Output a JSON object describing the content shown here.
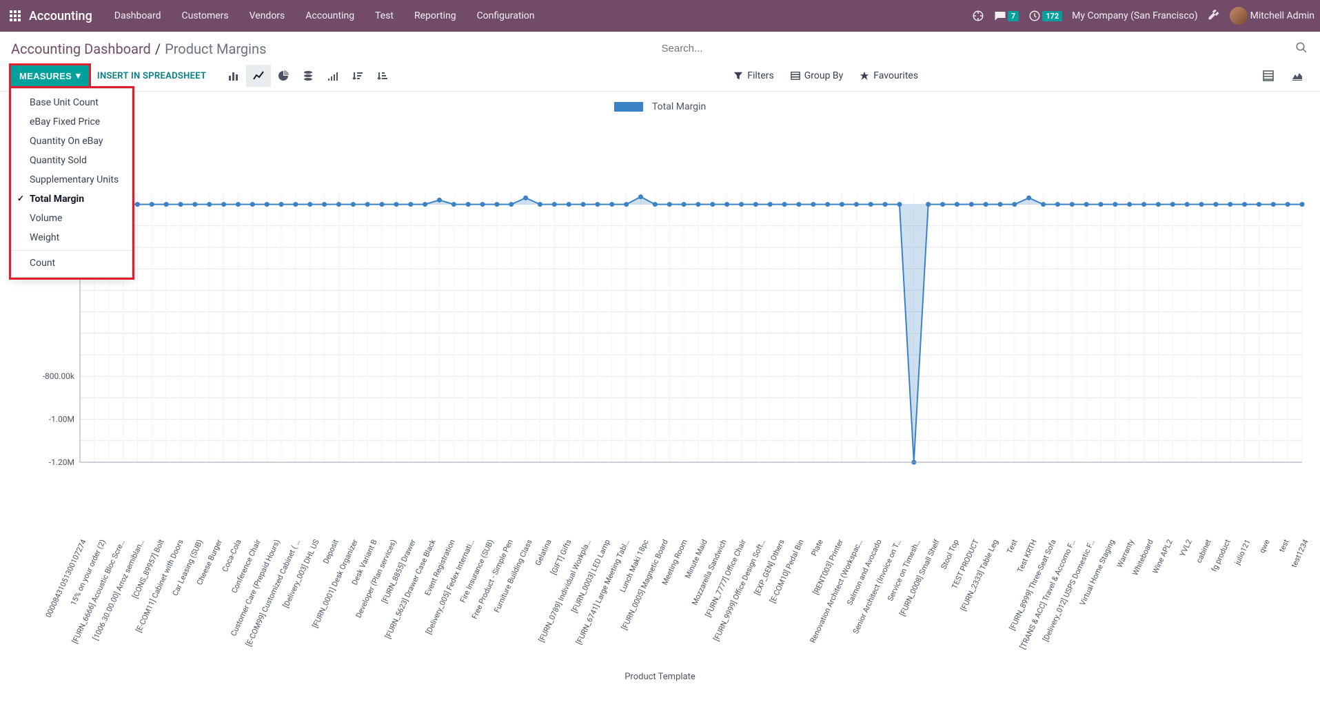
{
  "topbar": {
    "brand": "Accounting",
    "menu": [
      "Dashboard",
      "Customers",
      "Vendors",
      "Accounting",
      "Test",
      "Reporting",
      "Configuration"
    ],
    "msg_badge": "7",
    "clock_badge": "172",
    "company": "My Company (San Francisco)",
    "user": "Mitchell Admin"
  },
  "breadcrumb": {
    "parent": "Accounting Dashboard",
    "current": "Product Margins"
  },
  "search": {
    "placeholder": "Search..."
  },
  "buttons": {
    "measures": "MEASURES",
    "insert": "INSERT IN SPREADSHEET",
    "filters": "Filters",
    "groupby": "Group By",
    "favourites": "Favourites"
  },
  "measures_menu": {
    "items": [
      "Base Unit Count",
      "eBay Fixed Price",
      "Quantity On eBay",
      "Quantity Sold",
      "Supplementary Units",
      "Total Margin",
      "Volume",
      "Weight"
    ],
    "selected": "Total Margin",
    "footer": "Count"
  },
  "legend": {
    "label": "Total Margin"
  },
  "xlabel": "Product Template",
  "chart_data": {
    "type": "line",
    "title": "",
    "xlabel": "Product Template",
    "ylabel": "",
    "ylim": [
      -1200000,
      50000
    ],
    "yticks": [
      -1200000,
      -1000000,
      -800000
    ],
    "ytick_labels": [
      "-1.20M",
      "-1.00M",
      "-800.00k"
    ],
    "series": [
      {
        "name": "Total Margin",
        "values": [
          0,
          0,
          0,
          0,
          0,
          0,
          0,
          0,
          0,
          0,
          0,
          0,
          0,
          0,
          0,
          0,
          0,
          0,
          0,
          0,
          0,
          0,
          0,
          0,
          0,
          20000,
          0,
          0,
          0,
          0,
          0,
          30000,
          0,
          0,
          0,
          0,
          0,
          0,
          0,
          35000,
          0,
          0,
          0,
          0,
          0,
          0,
          0,
          0,
          0,
          0,
          0,
          0,
          0,
          0,
          0,
          0,
          0,
          0,
          -1200000,
          0,
          0,
          0,
          0,
          0,
          0,
          0,
          30000,
          0,
          0,
          0,
          0,
          0,
          0,
          0,
          0,
          0,
          0,
          0,
          0,
          0,
          0,
          0,
          0,
          0,
          0,
          0
        ]
      }
    ],
    "categories": [
      "00008431051300107274",
      "15% on your order (2)",
      "[FURN_6666] Acoustic Bloc Scre…",
      "[1006.30.00.00] Arroz semiblan…",
      "[CONS_89957] Bolt",
      "[E-COM11] Cabinet with Doors",
      "Car Leasing (SUB)",
      "Cheese Burger",
      "Coca-Cola",
      "Conference Chair",
      "Customer Care (Prepaid Hours)",
      "[E-COM99] Customized Cabinet ( …",
      "[Delivery_003] DHL US",
      "Deposit",
      "[FURN_0001] Desk Organizer",
      "Desk Variant B",
      "Developer (Plan services)",
      "[FURN_8855] Drawer",
      "[FURN_5623] Drawer Case Black",
      "Event Registration",
      "[Delivery_005] Fedex Internati…",
      "Fire Insurance (SUB)",
      "Free Product - Simple Pen",
      "Furniture Building Class",
      "Gelatina",
      "[GIFT] Gifts",
      "[FURN_0789] Individual Workpla…",
      "[FURN_0003] LED Lamp",
      "[FURN_6741] Large Meeting Tabl…",
      "Lunch Maki 18pc",
      "[FURN_0005] Magnetic Board",
      "Meeting Room",
      "Minute Maid",
      "Mozzarella Sandwich",
      "[FURN_7777] Office Chair",
      "[FURN_9999] Office Design Soft…",
      "[EXP_GEN] Others",
      "[E-COM10] Pedal Bin",
      "Plate",
      "[RENT003] Printer",
      "Renovation Architect (Workspac…",
      "Salmon and Avocado",
      "Senior Architect (Invoice on T…",
      "Service on Timesh…",
      "[FURN_0008] Small Shelf",
      "Stool Top",
      "TEST PRODUCT",
      "[FURN_2333] Table Leg",
      "Test",
      "Test KRTH",
      "[FURN_8999] Three-Seat Sofa",
      "[TRANS & ACC] Travel & Accomo F…",
      "[Delivery_012] USPS Domestic F…",
      "Virtual Home Staging",
      "Warranty",
      "Whiteboard",
      "Wine APL2",
      "YVL2",
      "cabinet",
      "fg product",
      "julio121",
      "qwe",
      "test",
      "test1234"
    ]
  }
}
